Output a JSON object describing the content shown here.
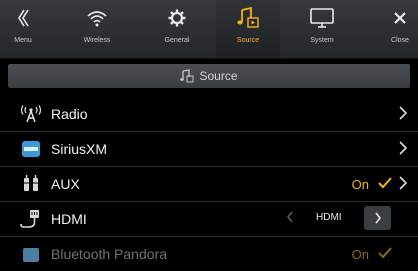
{
  "nav": [
    {
      "id": "menu",
      "label": "Menu",
      "icon": "back-chevron-icon"
    },
    {
      "id": "wireless",
      "label": "Wireless",
      "icon": "wifi-icon"
    },
    {
      "id": "general",
      "label": "General",
      "icon": "gear-icon"
    },
    {
      "id": "source",
      "label": "Source",
      "icon": "music-note-icon",
      "active": true
    },
    {
      "id": "system",
      "label": "System",
      "icon": "monitor-icon"
    },
    {
      "id": "close",
      "label": "Close",
      "icon": "close-icon"
    }
  ],
  "section": {
    "title": "Source",
    "icon": "music-note-icon"
  },
  "rows": [
    {
      "label": "Radio",
      "icon": "antenna-icon",
      "control": "chevron"
    },
    {
      "label": "SiriusXM",
      "icon": "siriusxm-icon",
      "control": "chevron"
    },
    {
      "label": "AUX",
      "icon": "aux-plug-icon",
      "control": "toggle",
      "status": "On",
      "checked": true
    },
    {
      "label": "HDMI",
      "icon": "hdmi-cable-icon",
      "control": "selector",
      "value": "HDMI"
    },
    {
      "label": "Bluetooth Pandora",
      "icon": "bluetooth-pandora-icon",
      "control": "toggle",
      "status": "On",
      "checked": true
    }
  ],
  "colors": {
    "accent": "#f6b417",
    "topbar": "#2d3034",
    "background": "#000000"
  }
}
